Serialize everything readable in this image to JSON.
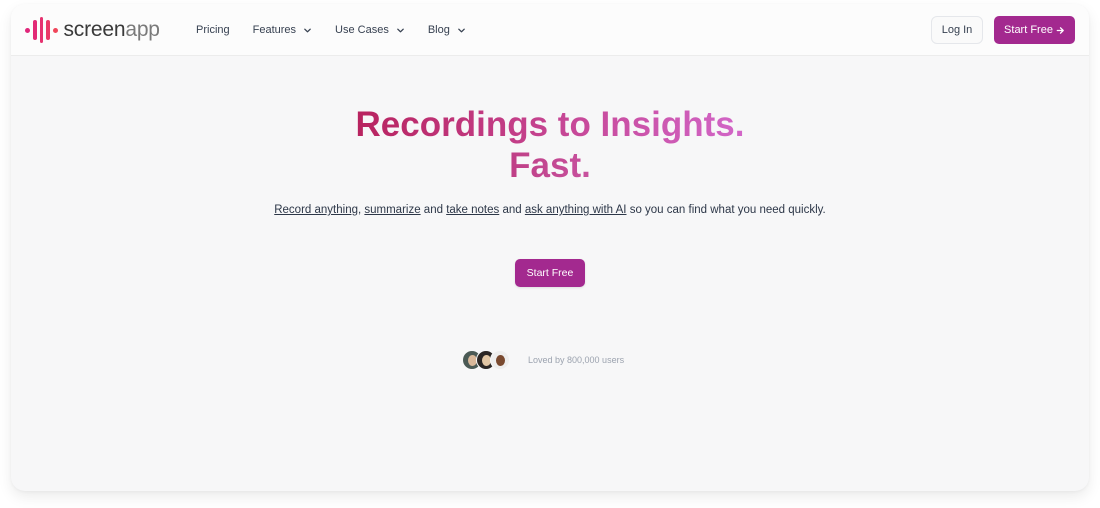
{
  "brand": {
    "name_part1": "screen",
    "name_part2": "app",
    "logo_icon": "sound-wave-icon",
    "colors": {
      "logo_gradient_start": "#e0267a",
      "logo_gradient_end": "#f0455a",
      "accent": "#a3298f",
      "title_gradient_start": "#b8235f",
      "title_gradient_end": "#d266c8"
    }
  },
  "nav": {
    "items": [
      {
        "label": "Pricing",
        "has_dropdown": false
      },
      {
        "label": "Features",
        "has_dropdown": true
      },
      {
        "label": "Use Cases",
        "has_dropdown": true
      },
      {
        "label": "Blog",
        "has_dropdown": true
      }
    ],
    "login_label": "Log In",
    "start_free_label": "Start Free",
    "start_free_icon": "arrow-right-icon"
  },
  "hero": {
    "title_line1": "Recordings to Insights.",
    "title_line2": "Fast.",
    "subtitle": {
      "link1": "Record anything",
      "sep1": ", ",
      "link2": "summarize",
      "sep2": " and ",
      "link3": "take notes",
      "sep3": " and ",
      "link4": "ask anything with AI",
      "rest": " so you can find what you need quickly."
    },
    "cta_label": "Start Free"
  },
  "social_proof": {
    "text": "Loved by 800,000 users",
    "avatars": [
      "user-avatar-1",
      "user-avatar-2",
      "user-avatar-3"
    ]
  }
}
